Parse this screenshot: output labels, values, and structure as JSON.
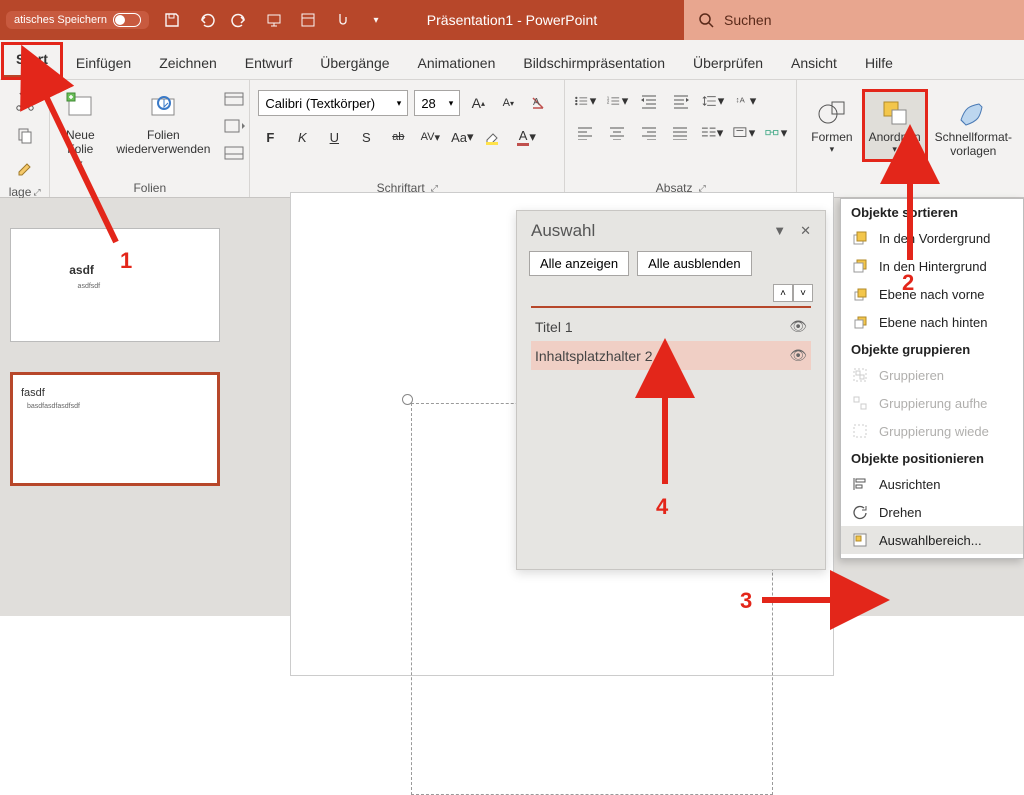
{
  "titlebar": {
    "autosave_label": "atisches Speichern",
    "title": "Präsentation1 - PowerPoint",
    "search_placeholder": "Suchen"
  },
  "tabs": {
    "start": "Start",
    "einfuegen": "Einfügen",
    "zeichnen": "Zeichnen",
    "entwurf": "Entwurf",
    "uebergaenge": "Übergänge",
    "animationen": "Animationen",
    "bildschirm": "Bildschirmpräsentation",
    "ueberpruefen": "Überprüfen",
    "ansicht": "Ansicht",
    "hilfe": "Hilfe"
  },
  "ribbon": {
    "clipboard_label": "lage",
    "neue_folie": "Neue Folie",
    "folien_wieder": "Folien wiederverwenden",
    "folien_label": "Folien",
    "font_name": "Calibri (Textkörper)",
    "font_size": "28",
    "schriftart_label": "Schriftart",
    "absatz_label": "Absatz",
    "formen": "Formen",
    "anordnen": "Anordnen",
    "schnell": "Schnellformat-vorlagen",
    "bold": "F",
    "italic": "K",
    "underline": "U",
    "shadow": "S",
    "strike": "ab",
    "spacing": "AV",
    "case": "Aa",
    "fontcolor": "A"
  },
  "menu": {
    "sort_hdr": "Objekte sortieren",
    "vordergrund": "In den Vordergrund",
    "hintergrund": "In den Hintergrund",
    "ebene_vorne": "Ebene nach vorne",
    "ebene_hinten": "Ebene nach hinten",
    "group_hdr": "Objekte gruppieren",
    "gruppieren": "Gruppieren",
    "aufheben": "Gruppierung aufhe",
    "wieder": "Gruppierung wiede",
    "pos_hdr": "Objekte positionieren",
    "ausrichten": "Ausrichten",
    "drehen": "Drehen",
    "auswahlbereich": "Auswahlbereich..."
  },
  "selection_pane": {
    "title": "Auswahl",
    "show_all": "Alle anzeigen",
    "hide_all": "Alle ausblenden",
    "items": [
      {
        "label": "Titel 1"
      },
      {
        "label": "Inhaltsplatzhalter 2"
      }
    ]
  },
  "thumbs": {
    "slide1_title": "asdf",
    "slide1_sub": "asdfsdf",
    "slide2_title": "fasdf",
    "slide2_sub": "basdfasdfasdfsdf"
  },
  "annotations": {
    "n1": "1",
    "n2": "2",
    "n3": "3",
    "n4": "4"
  }
}
